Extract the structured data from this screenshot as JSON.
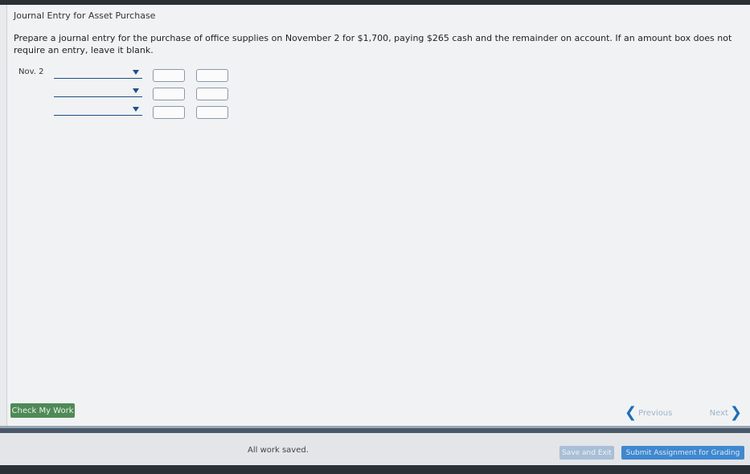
{
  "page": {
    "title": "Journal Entry for Asset Purchase",
    "instructions": "Prepare a journal entry for the purchase of office supplies on November 2 for $1,700, paying $265 cash and the remainder on account. If an amount box does not require an entry, leave it blank."
  },
  "journal": {
    "date_label": "Nov. 2",
    "rows": [
      {
        "account": "",
        "debit": "",
        "credit": ""
      },
      {
        "account": "",
        "debit": "",
        "credit": ""
      },
      {
        "account": "",
        "debit": "",
        "credit": ""
      }
    ],
    "dropdown_icon": "caret-down-icon"
  },
  "actions": {
    "check_label": "Check My Work",
    "previous_label": "Previous",
    "next_label": "Next"
  },
  "footer": {
    "status": "All work saved.",
    "save_exit_label": "Save and Exit",
    "submit_label": "Submit Assignment for Grading"
  },
  "colors": {
    "accent_blue": "#1d6fb8",
    "check_green": "#4e8a56",
    "submit_blue": "#3f88cf"
  }
}
